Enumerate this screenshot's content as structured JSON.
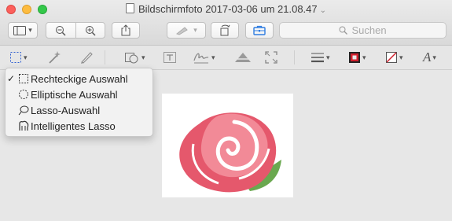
{
  "window": {
    "title": "Bildschirmfoto 2017-03-06 um 21.08.47"
  },
  "search": {
    "placeholder": "Suchen"
  },
  "selection_menu": {
    "items": [
      {
        "label": "Rechteckige Auswahl",
        "checked": true,
        "icon": "rect-select-icon"
      },
      {
        "label": "Elliptische Auswahl",
        "checked": false,
        "icon": "ellipse-select-icon"
      },
      {
        "label": "Lasso-Auswahl",
        "checked": false,
        "icon": "lasso-icon"
      },
      {
        "label": "Intelligentes Lasso",
        "checked": false,
        "icon": "smart-lasso-icon"
      }
    ]
  },
  "colors": {
    "rose_pink": "#e5586c",
    "rose_light": "#f28a97",
    "leaf": "#6aa84f",
    "accent": "#2f7de1"
  }
}
